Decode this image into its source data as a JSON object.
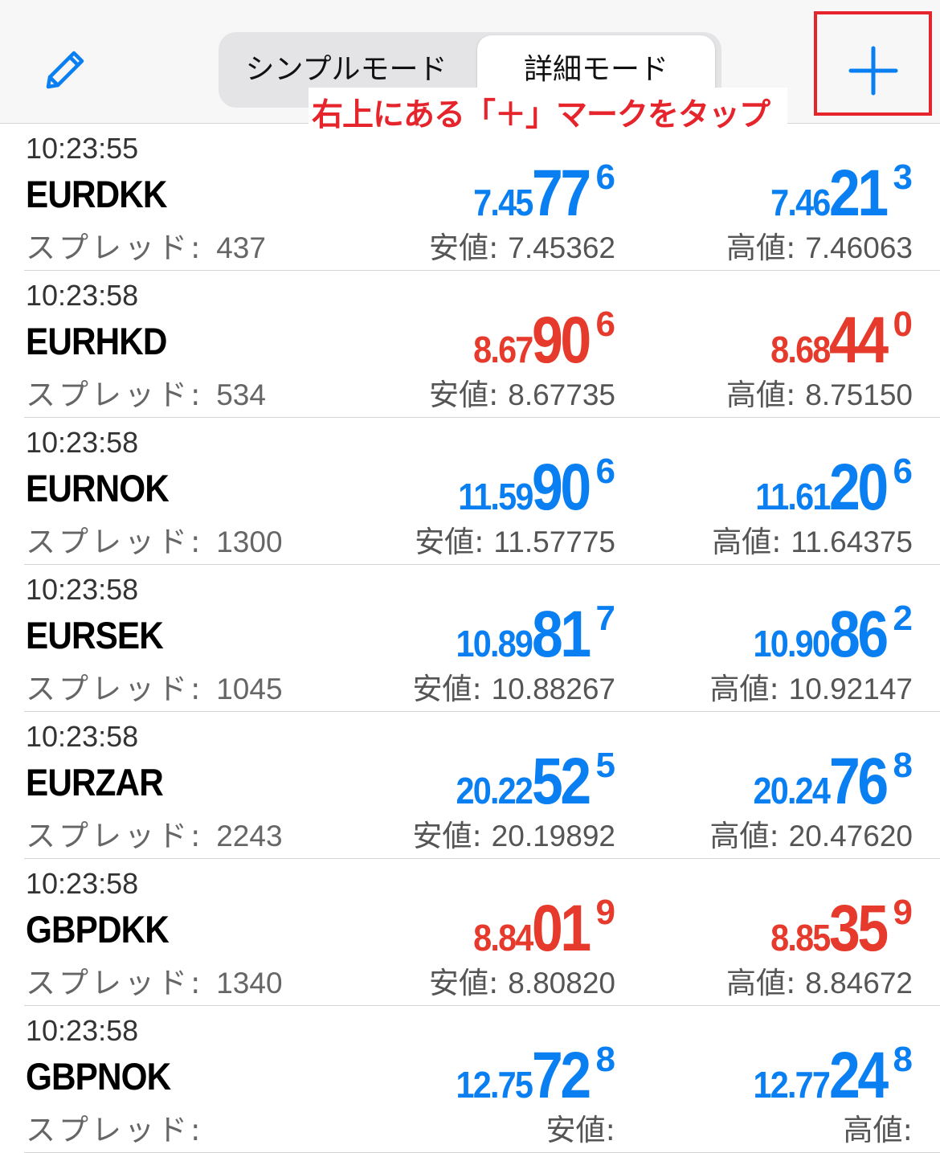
{
  "header": {
    "segments": [
      {
        "label": "シンプルモード",
        "active": false
      },
      {
        "label": "詳細モード",
        "active": true
      }
    ],
    "edit_icon": "pencil-icon",
    "add_icon": "plus-icon",
    "accent_color": "#0a7ff2",
    "annotation": {
      "text": "右上にある「＋」マークをタップ",
      "color": "#e5242c"
    }
  },
  "labels": {
    "spread": "スプレッド: ",
    "low": "安値: ",
    "high": "高値: "
  },
  "quotes": [
    {
      "time": "10:23:55",
      "symbol": "EURDKK",
      "spread": "437",
      "color": "blue",
      "bid": {
        "p1": "7.45",
        "p2": "77",
        "p3": "6"
      },
      "ask": {
        "p1": "7.46",
        "p2": "21",
        "p3": "3"
      },
      "low": "7.45362",
      "high": "7.46063"
    },
    {
      "time": "10:23:58",
      "symbol": "EURHKD",
      "spread": "534",
      "color": "red",
      "bid": {
        "p1": "8.67",
        "p2": "90",
        "p3": "6"
      },
      "ask": {
        "p1": "8.68",
        "p2": "44",
        "p3": "0"
      },
      "low": "8.67735",
      "high": "8.75150"
    },
    {
      "time": "10:23:58",
      "symbol": "EURNOK",
      "spread": "1300",
      "color": "blue",
      "bid": {
        "p1": "11.59",
        "p2": "90",
        "p3": "6"
      },
      "ask": {
        "p1": "11.61",
        "p2": "20",
        "p3": "6"
      },
      "low": "11.57775",
      "high": "11.64375"
    },
    {
      "time": "10:23:58",
      "symbol": "EURSEK",
      "spread": "1045",
      "color": "blue",
      "bid": {
        "p1": "10.89",
        "p2": "81",
        "p3": "7"
      },
      "ask": {
        "p1": "10.90",
        "p2": "86",
        "p3": "2"
      },
      "low": "10.88267",
      "high": "10.92147"
    },
    {
      "time": "10:23:58",
      "symbol": "EURZAR",
      "spread": "2243",
      "color": "blue",
      "bid": {
        "p1": "20.22",
        "p2": "52",
        "p3": "5"
      },
      "ask": {
        "p1": "20.24",
        "p2": "76",
        "p3": "8"
      },
      "low": "20.19892",
      "high": "20.47620"
    },
    {
      "time": "10:23:58",
      "symbol": "GBPDKK",
      "spread": "1340",
      "color": "red",
      "bid": {
        "p1": "8.84",
        "p2": "01",
        "p3": "9"
      },
      "ask": {
        "p1": "8.85",
        "p2": "35",
        "p3": "9"
      },
      "low": "8.80820",
      "high": "8.84672"
    },
    {
      "time": "10:23:58",
      "symbol": "GBPNOK",
      "spread": "",
      "color": "blue",
      "bid": {
        "p1": "12.75",
        "p2": "72",
        "p3": "8"
      },
      "ask": {
        "p1": "12.77",
        "p2": "24",
        "p3": "8"
      },
      "low": "",
      "high": ""
    }
  ]
}
